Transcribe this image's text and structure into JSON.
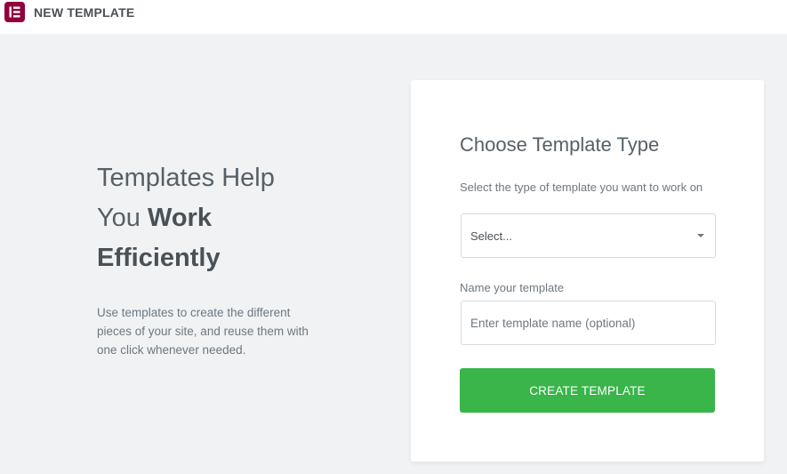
{
  "topbar": {
    "logo_icon": "elementor-logo-icon",
    "title": "NEW TEMPLATE"
  },
  "intro": {
    "headline_part1": "Templates Help",
    "headline_part2": "You ",
    "headline_bold": "Work Efficiently",
    "description": "Use templates to create the different pieces of your site, and reuse them with one click whenever needed."
  },
  "form": {
    "title": "Choose Template Type",
    "type_label": "Select the type of template you want to work on",
    "type_select_value": "Select...",
    "name_label": "Name your template",
    "name_placeholder": "Enter template name (optional)",
    "submit_label": "CREATE TEMPLATE"
  },
  "colors": {
    "brand": "#92003b",
    "button": "#39b54a",
    "background": "#f1f2f3"
  }
}
